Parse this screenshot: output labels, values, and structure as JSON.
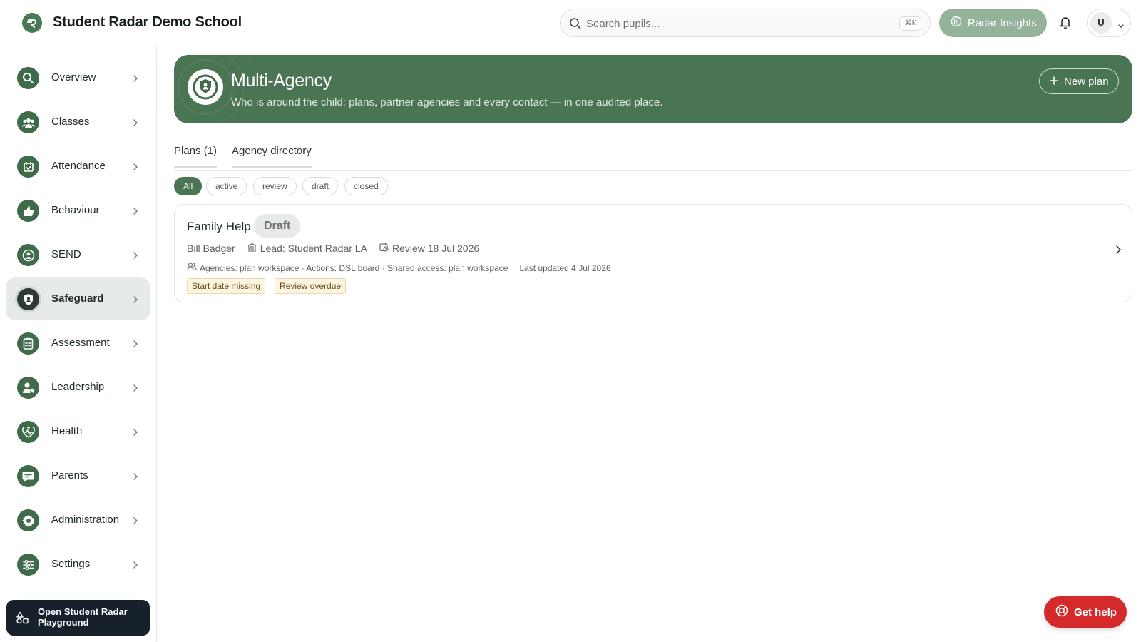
{
  "app": {
    "title": "Student Radar Demo School"
  },
  "header": {
    "search": {
      "placeholder": "Search pupils...",
      "shortcut": "⌘K"
    },
    "insights_label": "Radar Insights",
    "avatar_initial": "U"
  },
  "sidebar": {
    "items": [
      {
        "label": "Overview",
        "icon": "search-icon"
      },
      {
        "label": "Classes",
        "icon": "people-icon"
      },
      {
        "label": "Attendance",
        "icon": "calendar-check-icon"
      },
      {
        "label": "Behaviour",
        "icon": "thumbs-up-icon"
      },
      {
        "label": "SEND",
        "icon": "person-circle-icon"
      },
      {
        "label": "Safeguard",
        "icon": "shield-person-icon",
        "active": true
      },
      {
        "label": "Assessment",
        "icon": "clipboard-icon"
      },
      {
        "label": "Leadership",
        "icon": "user-star-icon"
      },
      {
        "label": "Health",
        "icon": "heart-pulse-icon"
      },
      {
        "label": "Parents",
        "icon": "chat-icon"
      },
      {
        "label": "Administration",
        "icon": "gear-icon"
      },
      {
        "label": "Settings",
        "icon": "sliders-icon"
      }
    ],
    "playground_label": "Open Student Radar Playground"
  },
  "hero": {
    "title": "Multi-Agency",
    "subtitle": "Who is around the child: plans, partner agencies and every contact — in one audited place.",
    "new_plan_label": "New plan"
  },
  "tabs": [
    {
      "label": "Plans (1)"
    },
    {
      "label": "Agency directory"
    }
  ],
  "filters": [
    {
      "label": "All",
      "selected": true
    },
    {
      "label": "active"
    },
    {
      "label": "review"
    },
    {
      "label": "draft"
    },
    {
      "label": "closed"
    }
  ],
  "plans": [
    {
      "title": "Family Help",
      "status": "Draft",
      "pupil": "Bill Badger",
      "lead": "Lead: Student Radar LA",
      "review": "Review 18 Jul 2026",
      "details": "Agencies: plan workspace · Actions: DSL board · Shared access: plan workspace",
      "updated": "Last updated 4 Jul 2026",
      "flags": [
        "Start date missing",
        "Review overdue"
      ]
    }
  ],
  "help_label": "Get help",
  "colors": {
    "brand": "#4a7553",
    "nav_icon": "#3f6b4a",
    "help": "#d42a2a",
    "flag_bg": "#fdf5e3"
  }
}
